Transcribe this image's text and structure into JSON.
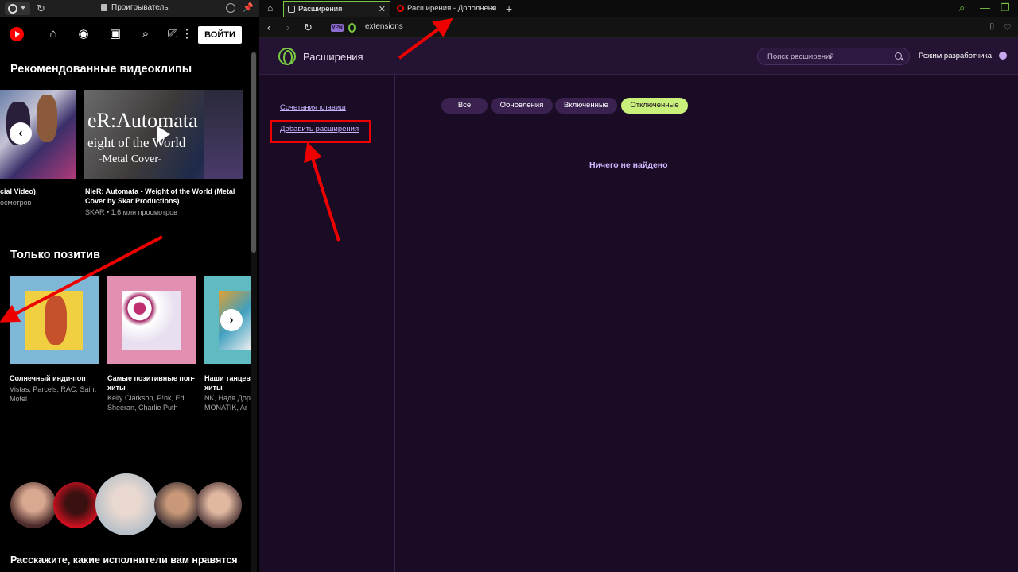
{
  "left_panel": {
    "window_title": "Проигрыватель",
    "login_button": "ВОЙТИ",
    "section1_title": "Рекомендованные видеоклипы",
    "videos": [
      {
        "title": "cial Video)",
        "subtitle": "осмотров"
      },
      {
        "title": "NieR: Automata - Weight of the World (Metal Cover by Skar Productions)",
        "subtitle": "SKAR • 1,6 млн просмотров",
        "thumb_line1": "eR:Automata",
        "thumb_line2": "eight of the World",
        "thumb_line3": "-Metal Cover-"
      }
    ],
    "section2_title": "Только позитив",
    "playlists": [
      {
        "title": "Солнечный инди-поп",
        "subtitle": "Vistas, Parcels, RAC, Saint Motel"
      },
      {
        "title": "Самые позитивные поп-хиты",
        "subtitle": "Kelly Clarkson, P!nk, Ed Sheeran, Charlie Puth"
      },
      {
        "title": "Наши танцев хиты",
        "subtitle": "NK, Надя Дор MONATIK, Ar"
      }
    ],
    "bottom_text": "Расскажите, какие исполнители вам нравятся"
  },
  "browser": {
    "tabs": [
      {
        "label": "Расширения"
      },
      {
        "label": "Расширения - Дополнени"
      }
    ],
    "vpn_badge": "VPN",
    "url": "extensions"
  },
  "extensions_page": {
    "title": "Расширения",
    "search_placeholder": "Поиск расширений",
    "dev_mode_label": "Режим разработчика",
    "sidebar_links": [
      "Сочетания клавиш",
      "Добавить расширения"
    ],
    "filters": [
      {
        "label": "Все",
        "selected": false
      },
      {
        "label": "Обновления",
        "selected": false
      },
      {
        "label": "Включенные",
        "selected": false
      },
      {
        "label": "Отключенные",
        "selected": true
      }
    ],
    "empty_message": "Ничего не найдено"
  },
  "colors": {
    "accent_green": "#7ac943",
    "page_bg": "#1b0c26",
    "selected_filter": "#c8f07a",
    "annotation_red": "#e00000"
  }
}
